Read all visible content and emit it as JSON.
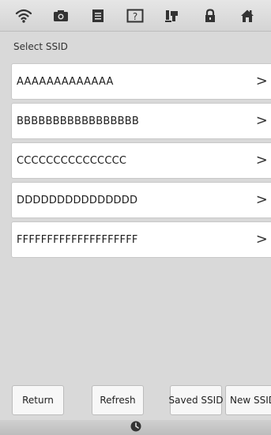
{
  "toolbar": {
    "icons": [
      "wifi-icon",
      "camera-icon",
      "document-icon",
      "help-icon",
      "embroidery-icon",
      "lock-icon",
      "home-icon"
    ]
  },
  "page": {
    "title": "Select SSID"
  },
  "ssids": [
    {
      "name": "AAAAAAAAAAAAA"
    },
    {
      "name": "BBBBBBBBBBBBBBBBB"
    },
    {
      "name": "CCCCCCCCCCCCCCC"
    },
    {
      "name": "DDDDDDDDDDDDDDD"
    },
    {
      "name": "FFFFFFFFFFFFFFFFFFFF"
    }
  ],
  "chevron": ">",
  "buttons": {
    "return": "Return",
    "refresh": "Refresh",
    "saved_ssid": "Saved SSID",
    "new_ssid": "New SSID"
  },
  "footer": {
    "icon": "clock-icon"
  },
  "colors": {
    "background": "#d9d9d9",
    "row": "#ffffff",
    "button": "#f7f7f7"
  }
}
